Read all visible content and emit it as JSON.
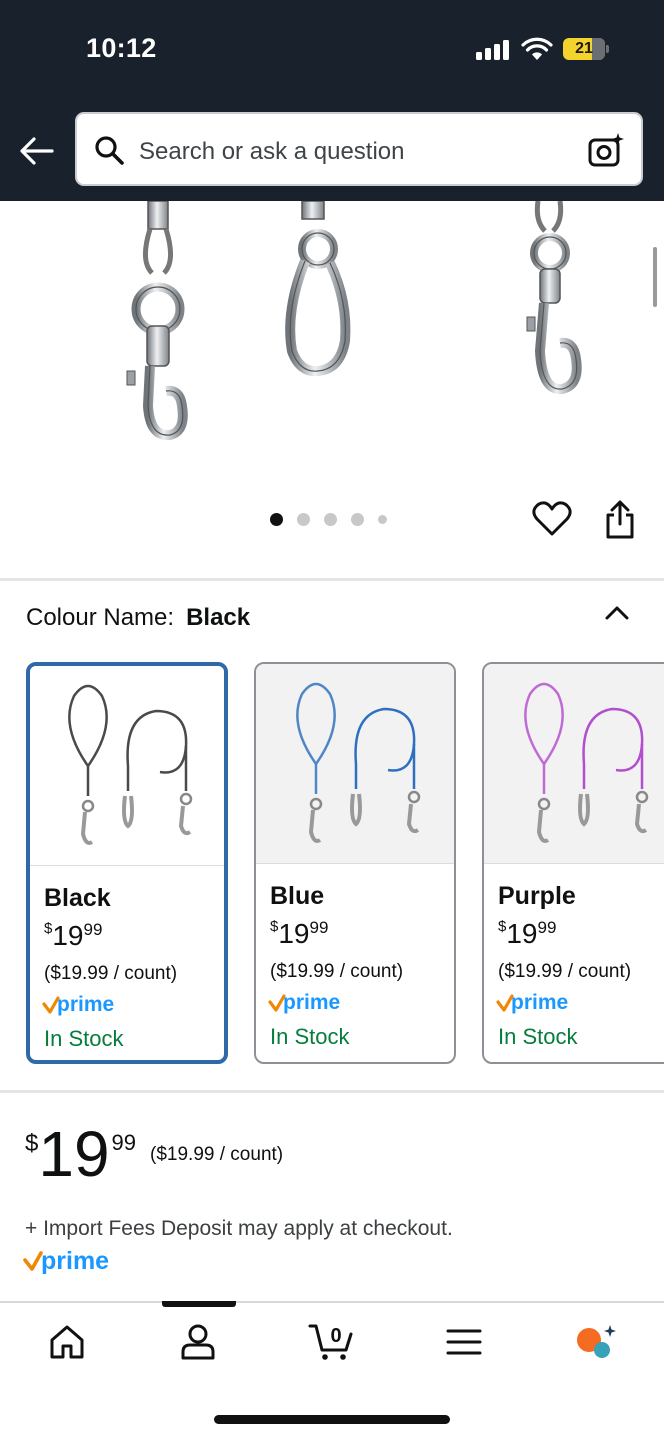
{
  "status_bar": {
    "time": "10:12",
    "battery": "21"
  },
  "header": {
    "search_placeholder": "Search or ask a question"
  },
  "gallery": {
    "image_count": 5,
    "active_index": 0
  },
  "colour": {
    "label": "Colour Name:",
    "selected": "Black",
    "options": [
      {
        "name": "Black",
        "currency": "$",
        "whole": "19",
        "cents": "99",
        "unit_price": "($19.99 / count)",
        "prime": "prime",
        "stock": "In Stock",
        "color": "#4a4a4a"
      },
      {
        "name": "Blue",
        "currency": "$",
        "whole": "19",
        "cents": "99",
        "unit_price": "($19.99 / count)",
        "prime": "prime",
        "stock": "In Stock",
        "color": "#2f6fc0"
      },
      {
        "name": "Purple",
        "currency": "$",
        "whole": "19",
        "cents": "99",
        "unit_price": "($19.99 / count)",
        "prime": "prime",
        "stock": "In Stock",
        "color": "#b14fcf"
      }
    ]
  },
  "price": {
    "currency": "$",
    "whole": "19",
    "cents": "99",
    "unit_price": "($19.99 / count)",
    "import_note": "+ Import Fees Deposit may apply at checkout.",
    "prime": "prime"
  },
  "bottom_nav": {
    "items": [
      "home-icon",
      "account-icon",
      "cart-icon",
      "menu-icon",
      "rufus-icon"
    ],
    "cart_count": "0",
    "active": "account-icon"
  },
  "colors": {
    "header_bg": "#19212c",
    "selected_border": "#2f6aa7",
    "in_stock": "#067d3d",
    "prime_blue": "#1a98ff",
    "prime_check": "#f08804"
  }
}
